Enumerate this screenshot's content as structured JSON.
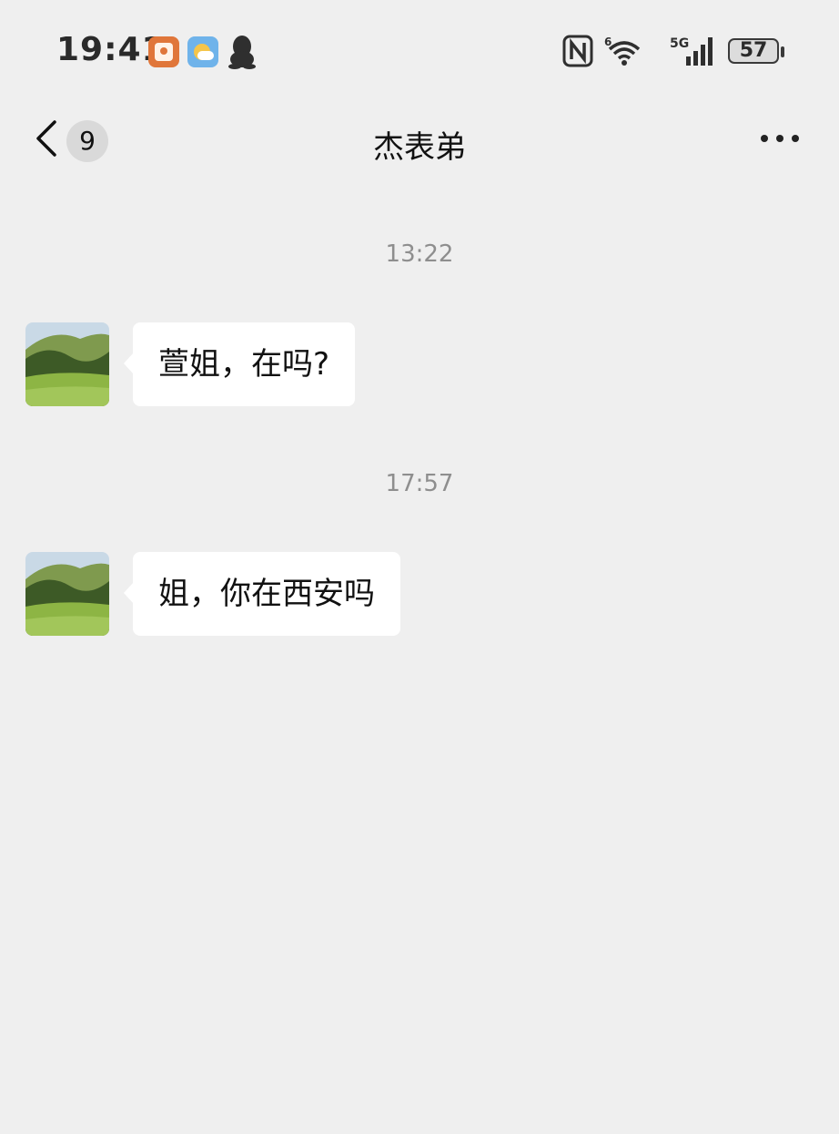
{
  "status_bar": {
    "time": "19:41",
    "battery": "57",
    "icons": [
      "red-app-icon",
      "weather-icon",
      "qq-icon",
      "nfc-icon",
      "wifi-icon",
      "signal-5g-icon",
      "battery-icon"
    ]
  },
  "nav": {
    "unread_count": "9",
    "title": "杰表弟",
    "icons": [
      "back-icon",
      "more-icon"
    ]
  },
  "messages": [
    {
      "timestamp": "13:22",
      "text": "萱姐，在吗?"
    },
    {
      "timestamp": "17:57",
      "text": "姐，你在西安吗"
    }
  ],
  "colors": {
    "background": "#efefef",
    "bubble": "#ffffff",
    "timestamp": "#8e8e8e"
  }
}
